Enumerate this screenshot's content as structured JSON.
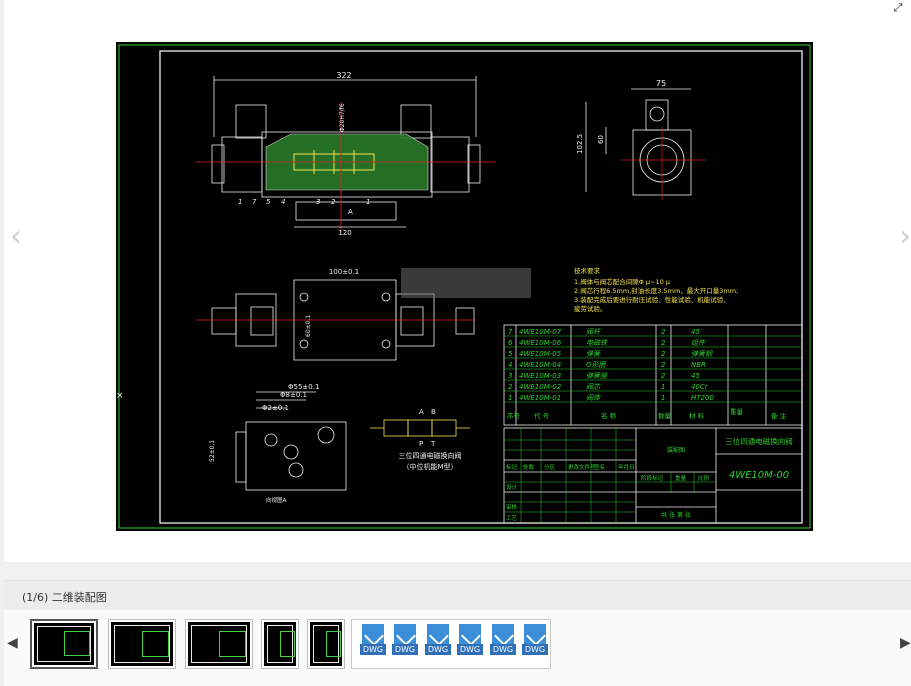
{
  "viewer": {
    "expand_icon": "expand-icon",
    "prev_icon": "chevron-left-icon",
    "next_icon": "chevron-right-icon"
  },
  "drawing": {
    "dims": {
      "overall_length": "322",
      "width": "75",
      "height": "102.5",
      "inner_height": "60",
      "port_spacing": "120",
      "body_length": "100±0.1",
      "side_dim": "60±0.1",
      "d1": "Φ55±0.1",
      "d2": "Φ8±0.1",
      "d3": "Φ2±0.1",
      "d4": "52±0.1",
      "fit": "Φ20H7/f6",
      "port_a": "A"
    },
    "part_numbers": [
      "1",
      "2",
      "3",
      "4",
      "5",
      "6",
      "7"
    ],
    "symbol_labels": {
      "a": "A",
      "b": "B",
      "p": "P",
      "t": "T"
    },
    "symbol_caption_1": "三位四通电磁换向阀",
    "symbol_caption_2": "（中位机能M型）",
    "view_caption": "向视图A",
    "tech_req_title": "技术要求",
    "tech_req_lines": [
      "1.阀体与阀芯配合间隙Φ μ~10 μ",
      "2.阀芯行程6.5mm,封油长度3.5mm，最大开口量3mm;",
      "3.装配完成后要进行耐压试验、性能试验、机能试验、",
      "  疲劳试验。"
    ],
    "bom": [
      {
        "no": "7",
        "code": "4WE10M-07",
        "name": "阀杆",
        "qty": "2",
        "mat": "45"
      },
      {
        "no": "6",
        "code": "4WE10M-06",
        "name": "电磁铁",
        "qty": "2",
        "mat": "组件"
      },
      {
        "no": "5",
        "code": "4WE10M-05",
        "name": "弹簧",
        "qty": "2",
        "mat": "弹簧钢"
      },
      {
        "no": "4",
        "code": "4WE10M-04",
        "name": "O形圈",
        "qty": "2",
        "mat": "NBR"
      },
      {
        "no": "3",
        "code": "4WE10M-03",
        "name": "弹簧座",
        "qty": "2",
        "mat": "45"
      },
      {
        "no": "2",
        "code": "4WE10M-02",
        "name": "阀芯",
        "qty": "1",
        "mat": "40Cr"
      },
      {
        "no": "1",
        "code": "4WE10M-01",
        "name": "阀体",
        "qty": "1",
        "mat": "HT200"
      }
    ],
    "bom_header": {
      "no": "序号",
      "code": "代 号",
      "name": "名 称",
      "qty": "数量",
      "mat": "材 料",
      "weight": "重量",
      "remark": "备 注"
    },
    "title_block": {
      "title": "三位四通电磁换向阀",
      "drawing_no": "4WE10M-00",
      "view_label": "装配图",
      "company": "共 张 第 张",
      "rows": [
        "标记",
        "设计",
        "审核",
        "工艺"
      ],
      "cols": [
        "处数",
        "分区",
        "更改文件号",
        "签名",
        "年月日"
      ],
      "extra": [
        "阶段标记",
        "重量",
        "比例"
      ]
    },
    "colors": {
      "green": "#2fd12f",
      "yellow": "#f2e14a",
      "red": "#e02020",
      "white": "#eeeeee",
      "cyan": "#27c8d8"
    }
  },
  "caption": "(1/6) 二维装配图",
  "thumbnails": [
    {
      "kind": "drawing",
      "label": "thumbnail-1"
    },
    {
      "kind": "drawing",
      "label": "thumbnail-2"
    },
    {
      "kind": "drawing",
      "label": "thumbnail-3"
    },
    {
      "kind": "drawing",
      "label": "thumbnail-4"
    },
    {
      "kind": "drawing",
      "label": "thumbnail-5"
    }
  ],
  "dwg_files": [
    "DWG",
    "DWG",
    "DWG",
    "DWG",
    "DWG",
    "DWG"
  ],
  "strip_prev_icon": "triangle-left-icon",
  "strip_next_icon": "triangle-right-icon"
}
